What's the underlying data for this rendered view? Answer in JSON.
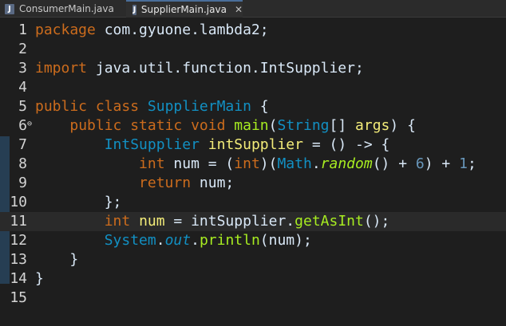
{
  "tabs": [
    {
      "label": "ConsumerMain.java",
      "active": false
    },
    {
      "label": "SupplierMain.java",
      "active": true
    }
  ],
  "editor": {
    "lines": [
      {
        "n": "1",
        "t": [
          [
            "kw",
            "package"
          ],
          [
            "txt",
            " com.gyuone.lambda2;"
          ]
        ]
      },
      {
        "n": "2",
        "t": []
      },
      {
        "n": "3",
        "t": [
          [
            "kw",
            "import"
          ],
          [
            "txt",
            " java.util.function.IntSupplier;"
          ]
        ]
      },
      {
        "n": "4",
        "t": []
      },
      {
        "n": "5",
        "t": [
          [
            "kw",
            "public class"
          ],
          [
            "txt",
            " "
          ],
          [
            "cls",
            "SupplierMain"
          ],
          [
            "txt",
            " {"
          ]
        ]
      },
      {
        "n": "6",
        "fold": true,
        "t": [
          [
            "txt",
            "    "
          ],
          [
            "kw",
            "public static void"
          ],
          [
            "txt",
            " "
          ],
          [
            "meth",
            "main"
          ],
          [
            "txt",
            "("
          ],
          [
            "cls",
            "String"
          ],
          [
            "txt",
            "[] "
          ],
          [
            "var",
            "args"
          ],
          [
            "txt",
            ") {"
          ]
        ]
      },
      {
        "n": "7",
        "t": [
          [
            "txt",
            "        "
          ],
          [
            "cls",
            "IntSupplier"
          ],
          [
            "txt",
            " "
          ],
          [
            "var",
            "intSupplier"
          ],
          [
            "txt",
            " = () -> {"
          ]
        ]
      },
      {
        "n": "8",
        "t": [
          [
            "txt",
            "            "
          ],
          [
            "kw",
            "int"
          ],
          [
            "txt",
            " num = ("
          ],
          [
            "kw",
            "int"
          ],
          [
            "txt",
            ")("
          ],
          [
            "cls",
            "Math"
          ],
          [
            "txt",
            "."
          ],
          [
            "meth ital",
            "random"
          ],
          [
            "txt",
            "() + "
          ],
          [
            "lit",
            "6"
          ],
          [
            "txt",
            ") + "
          ],
          [
            "lit",
            "1"
          ],
          [
            "txt",
            ";"
          ]
        ]
      },
      {
        "n": "9",
        "t": [
          [
            "txt",
            "            "
          ],
          [
            "kw",
            "return"
          ],
          [
            "txt",
            " num;"
          ]
        ]
      },
      {
        "n": "10",
        "t": [
          [
            "txt",
            "        };"
          ]
        ]
      },
      {
        "n": "11",
        "current": true,
        "t": [
          [
            "txt",
            "        "
          ],
          [
            "kw",
            "int"
          ],
          [
            "txt",
            " "
          ],
          [
            "var",
            "num"
          ],
          [
            "txt",
            " = intSupplier."
          ],
          [
            "meth",
            "getAsInt"
          ],
          [
            "txt",
            "();"
          ]
        ]
      },
      {
        "n": "12",
        "t": [
          [
            "txt",
            "        "
          ],
          [
            "cls",
            "System"
          ],
          [
            "txt",
            "."
          ],
          [
            "cls ital",
            "out"
          ],
          [
            "txt",
            "."
          ],
          [
            "meth",
            "println"
          ],
          [
            "txt",
            "(num);"
          ]
        ]
      },
      {
        "n": "13",
        "t": [
          [
            "txt",
            "    }"
          ]
        ]
      },
      {
        "n": "14",
        "t": [
          [
            "txt",
            "}"
          ]
        ]
      },
      {
        "n": "15",
        "t": []
      }
    ]
  },
  "icons": {
    "file": "java-file-icon",
    "close": "close-icon",
    "fold": "fold-minus-icon"
  }
}
